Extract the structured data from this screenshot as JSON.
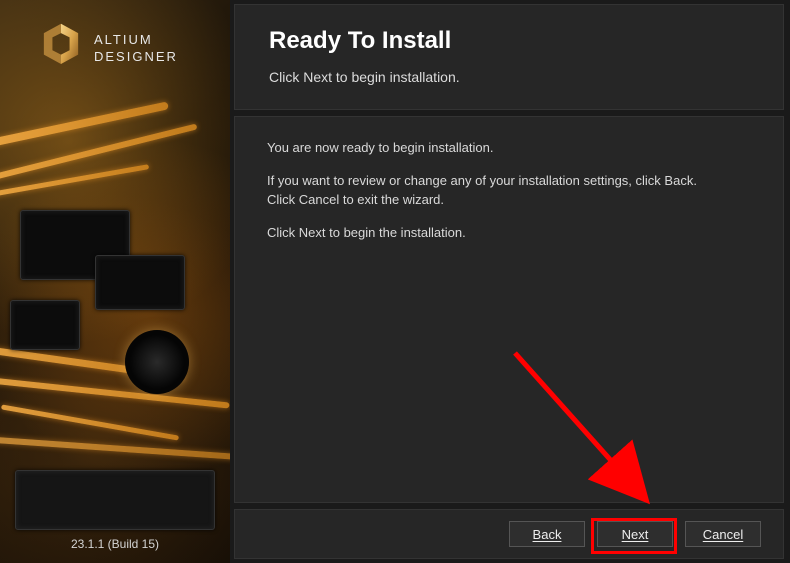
{
  "brand": {
    "line1": "ALTIUM",
    "line2": "DESIGNER"
  },
  "version": "23.1.1 (Build 15)",
  "header": {
    "title": "Ready To Install",
    "subtitle": "Click Next to begin installation."
  },
  "body": {
    "p1": "You are now ready to begin installation.",
    "p2": "If you want to review or change any of your installation settings, click Back.\nClick Cancel to exit the wizard.",
    "p3": "Click Next to begin the installation."
  },
  "buttons": {
    "back": "Back",
    "next": "Next",
    "cancel": "Cancel"
  }
}
